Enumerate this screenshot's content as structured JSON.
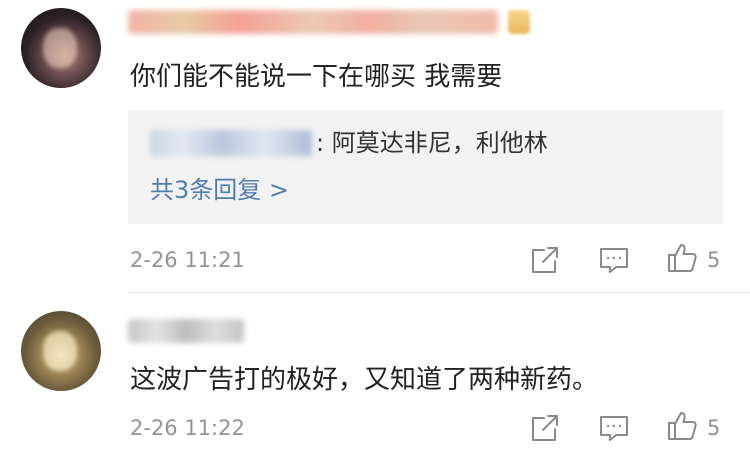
{
  "comments": [
    {
      "text": "你们能不能说一下在哪买 我需要",
      "reply": {
        "text": ": 阿莫达非尼，利他林",
        "more_label": "共3条回复 >"
      },
      "timestamp": "2-26 11:21",
      "likes": "5"
    },
    {
      "text": "这波广告打的极好，又知道了两种新药。",
      "timestamp": "2-26 11:22",
      "likes": "5"
    }
  ],
  "icons": {
    "share": "share-icon",
    "comment": "comment-icon",
    "like": "thumbs-up-icon"
  },
  "colors": {
    "link": "#507daf",
    "meta": "#939393",
    "reply_bg": "#f2f2f2"
  }
}
